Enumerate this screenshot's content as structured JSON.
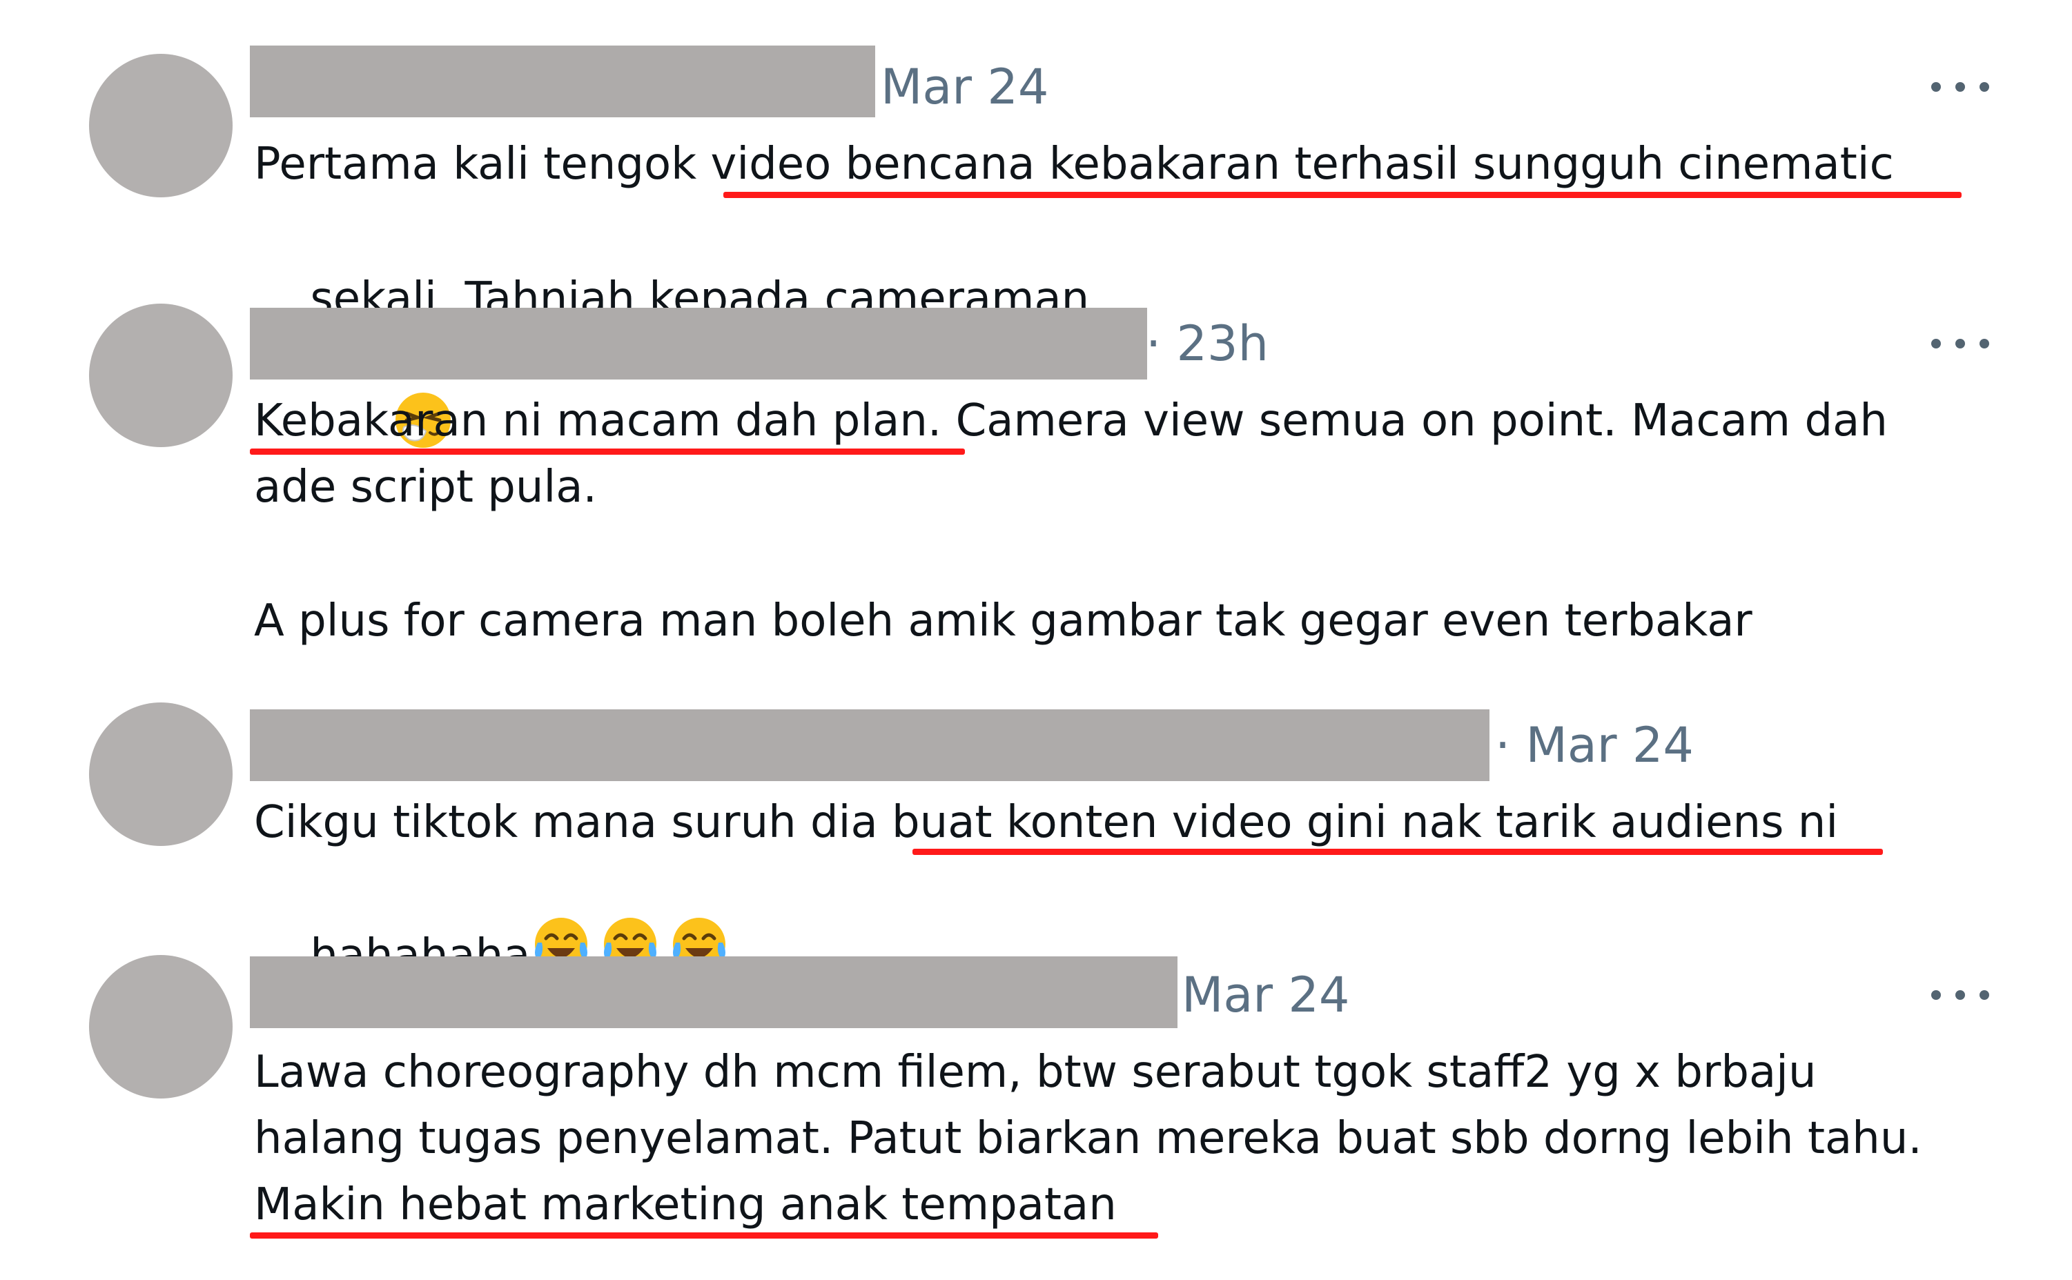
{
  "comments": [
    {
      "time": "Mar 24",
      "line1": "Pertama kali tengok video bencana kebakaran terhasil sungguh cinematic",
      "line2": "sekali. Tahniah kepada cameraman",
      "emoji": "sneezing-face"
    },
    {
      "time": "· 23h",
      "line1": "Kebakaran ni macam dah plan. Camera view semua on point. Macam dah",
      "line2": "ade script pula.",
      "line3": "A plus for camera man boleh amik gambar tak gegar even terbakar"
    },
    {
      "time": "· Mar 24",
      "line1": "Cikgu tiktok mana suruh dia buat konten video gini nak tarik audiens ni",
      "line2": "hahahaha",
      "emoji": "face-with-tears-of-joy"
    },
    {
      "time": "Mar 24",
      "line1": "Lawa choreography dh mcm filem, btw serabut tgok staff2 yg x brbaju",
      "line2": "halang tugas penyelamat. Patut biarkan mereka buat sbb dorng lebih tahu.",
      "line3": "Makin hebat marketing anak tempatan"
    }
  ],
  "colors": {
    "underline": "#ff1a1a",
    "redacted": "#aeabaa",
    "avatar": "#b3b0af",
    "timestamp": "#5b7083",
    "text": "#0f1419"
  }
}
